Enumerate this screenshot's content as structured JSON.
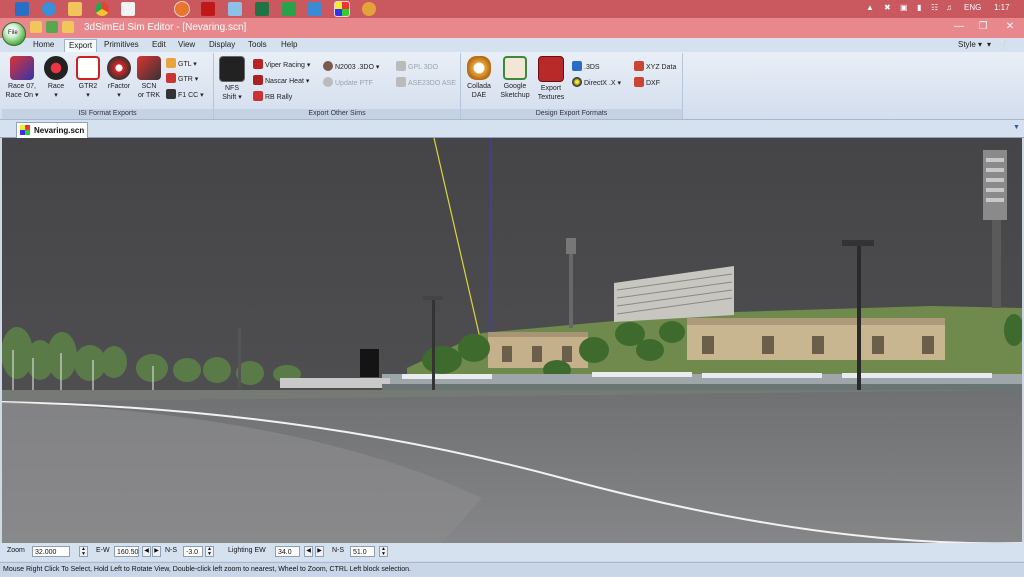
{
  "taskbar": {
    "tray_language": "ENG",
    "tray_time": "1:17",
    "icons": [
      "windows-icon",
      "ie-icon",
      "explorer-icon",
      "chrome-icon",
      "dev-icon",
      "firefox-icon",
      "acrobat-icon",
      "notepad-icon",
      "excel-icon",
      "word-icon",
      "onedrive-icon",
      "3dsimed-icon",
      "other-app-icon"
    ]
  },
  "window": {
    "title": "3dSimEd Sim Editor - [Nevaring.scn]",
    "file_orb_label": "File",
    "style_label": "Style"
  },
  "menu": {
    "items": [
      "Home",
      "Export",
      "Primitives",
      "Edit",
      "View",
      "Display",
      "Tools",
      "Help"
    ],
    "selected": "Export"
  },
  "ribbon": {
    "groups": {
      "isi": "ISI Format Exports",
      "other": "Export Other Sims",
      "design": "Design Export Formats"
    },
    "isi_buttons": {
      "race07": "Race 07,",
      "race07_sub": "Race On",
      "race": "Race",
      "gtr2": "GTR2",
      "rfactor": "rFactor",
      "scn": "SCN",
      "scn_sub": "or TRK",
      "gtl": "GTL",
      "gtr": "GTR",
      "f1cc": "F1 CC"
    },
    "other_buttons": {
      "nfs": "NFS",
      "nfs_sub": "Shift",
      "viper": "Viper Racing",
      "nascar": "Nascar Heat",
      "rbrally": "RB Rally",
      "n2003": "N2003 .3DO",
      "update_ptf": "Update PTF",
      "gpl": "GPL 3DO",
      "ase2": "ASE23DO ASE"
    },
    "design_buttons": {
      "collada": "Collada",
      "collada_sub": "DAE",
      "sketchup": "Google",
      "sketchup_sub": "Sketchup",
      "textures": "Export",
      "textures_sub": "Textures",
      "threeds": ".3DS",
      "directx": "DirectX .X",
      "xyz": "XYZ Data",
      "dxf": "DXF"
    },
    "colors": {
      "accent": "#c9585f",
      "title": "#e8888d",
      "ribbon": "#d6e1ef"
    }
  },
  "document": {
    "tab_label": "Nevaring.scn"
  },
  "controls": {
    "zoom_label": "Zoom",
    "zoom_value": "32.000",
    "ew_label": "E-W",
    "ew_value": "160.500",
    "ns_label": "N-S",
    "ns_value": "-3.0",
    "lighting_ew_label": "Lighting EW",
    "lighting_ew_value": "34.0",
    "lighting_ns_label": "N-S",
    "lighting_ns_value": "51.0"
  },
  "status": {
    "text": "Mouse Right Click To Select, Hold Left to Rotate View, Double-click left  zoom to nearest, Wheel to Zoom, CTRL Left block selection."
  }
}
